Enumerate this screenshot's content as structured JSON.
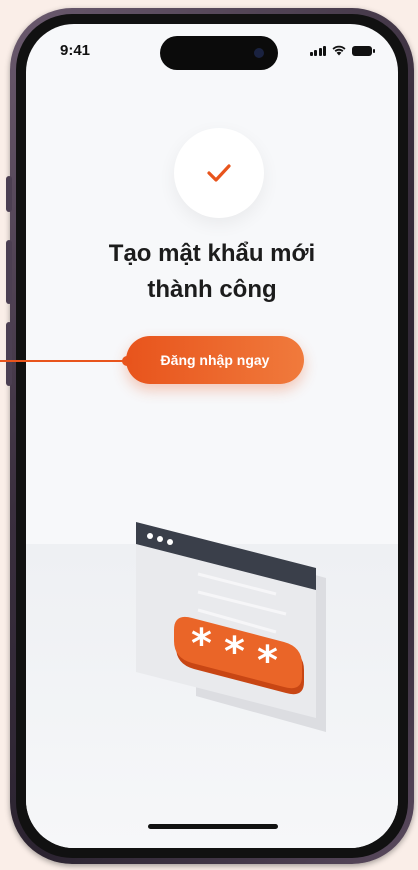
{
  "status_bar": {
    "time": "9:41"
  },
  "main": {
    "title_line1": "Tạo mật khẩu mới",
    "title_line2": "thành công",
    "login_button_label": "Đăng nhập ngay"
  },
  "colors": {
    "accent": "#e8541c",
    "text": "#1c1c1c",
    "background": "#f7f8fa"
  }
}
